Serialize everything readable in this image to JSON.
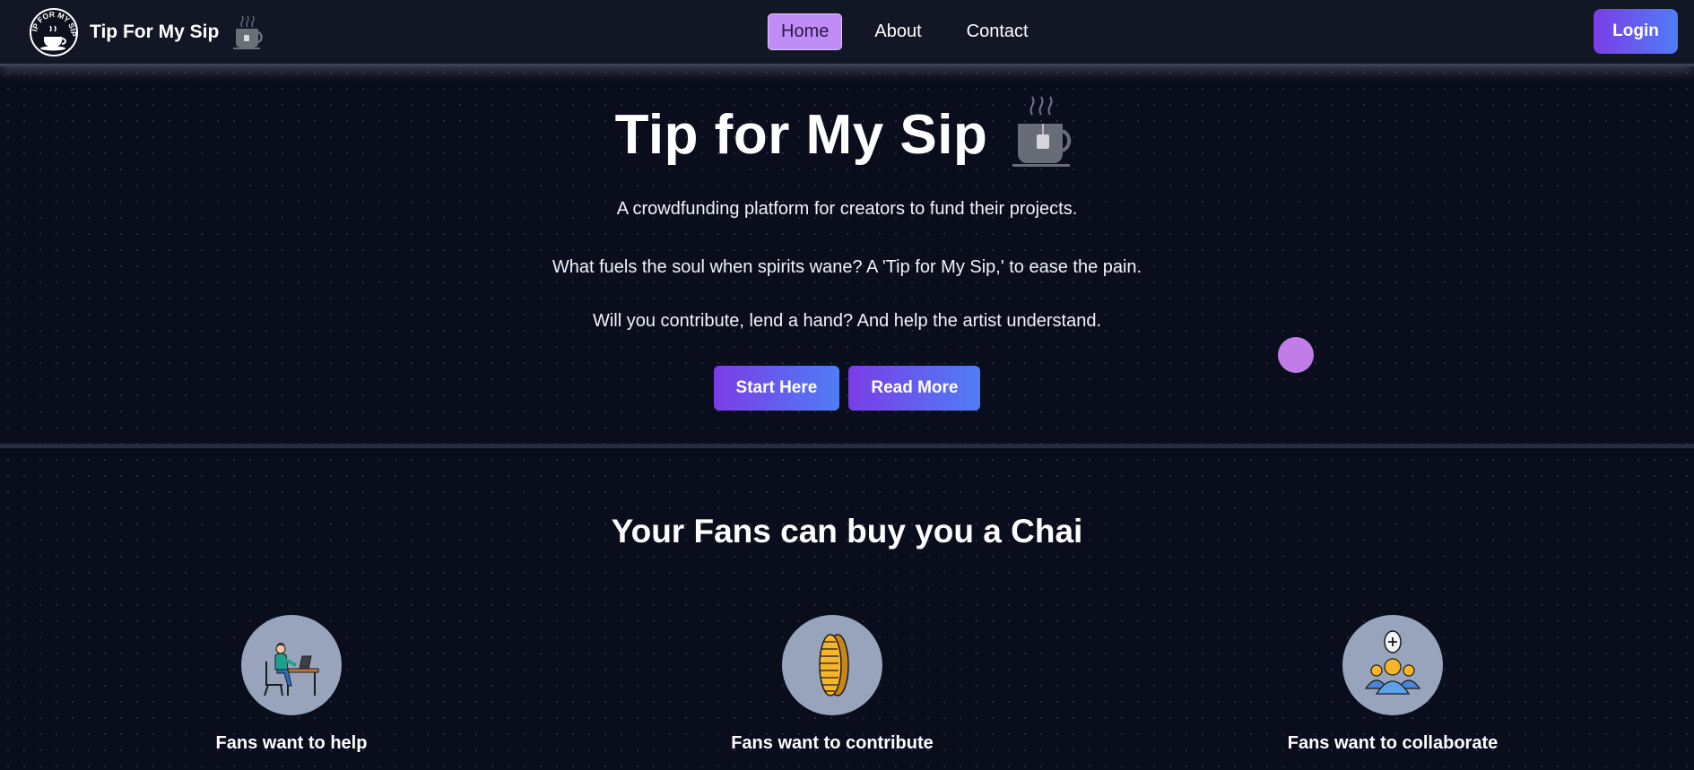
{
  "navbar": {
    "brand_name": "Tip For My Sip",
    "logo_text": "TIP FOR MY SIP",
    "links": [
      {
        "label": "Home",
        "active": true
      },
      {
        "label": "About",
        "active": false
      },
      {
        "label": "Contact",
        "active": false
      }
    ],
    "login_label": "Login"
  },
  "hero": {
    "title": "Tip for My Sip",
    "tagline": "A crowdfunding platform for creators to fund their projects.",
    "verse1": "What fuels the soul when spirits wane? A 'Tip for My Sip,' to ease the pain.",
    "verse2": "Will you contribute, lend a hand? And help the artist understand.",
    "start_label": "Start Here",
    "read_more_label": "Read More"
  },
  "fans_section": {
    "title": "Your Fans can buy you a Chai",
    "features": [
      {
        "label": "Fans want to help",
        "icon": "person-at-desk-icon"
      },
      {
        "label": "Fans want to contribute",
        "icon": "gold-coin-icon"
      },
      {
        "label": "Fans want to collaborate",
        "icon": "group-add-icon"
      }
    ]
  },
  "colors": {
    "background": "#0a0d1c",
    "navbar": "#121726",
    "active_tab": "#c08cf5",
    "gradient_start": "#7b3de6",
    "gradient_end": "#4f7df5",
    "icon_circle": "#97a4bb"
  }
}
